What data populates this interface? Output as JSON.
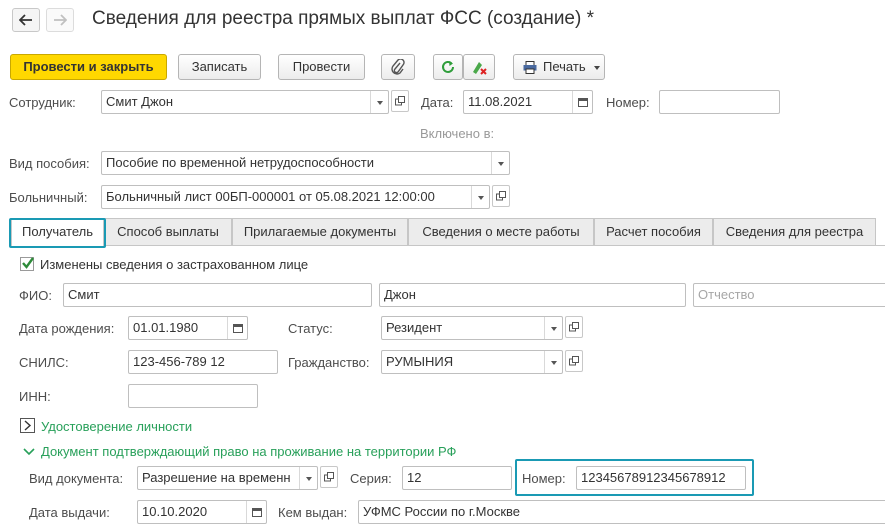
{
  "window": {
    "title": "Сведения для реестра прямых выплат ФСС (создание) *"
  },
  "toolbar": {
    "post_close": "Провести и закрыть",
    "save": "Записать",
    "post": "Провести",
    "print": "Печать"
  },
  "header": {
    "employee_label": "Сотрудник:",
    "employee_value": "Смит Джон",
    "date_label": "Дата:",
    "date_value": "11.08.2021",
    "number_label": "Номер:",
    "number_value": "",
    "included_label": "Включено в:",
    "benefit_label": "Вид пособия:",
    "benefit_value": "Пособие по временной нетрудоспособности",
    "sickleave_label": "Больничный:",
    "sickleave_value": "Больничный лист 00БП-000001 от 05.08.2021 12:00:00"
  },
  "tabs": [
    {
      "label": "Получатель",
      "active": true
    },
    {
      "label": "Способ выплаты",
      "active": false
    },
    {
      "label": "Прилагаемые документы",
      "active": false
    },
    {
      "label": "Сведения о месте работы",
      "active": false
    },
    {
      "label": "Расчет пособия",
      "active": false
    },
    {
      "label": "Сведения для реестра",
      "active": false
    }
  ],
  "recipient": {
    "changed_label": "Изменены сведения о застрахованном лице",
    "changed_checked": true,
    "fio_label": "ФИО:",
    "last_name": "Смит",
    "first_name": "Джон",
    "middle_name_placeholder": "Отчество",
    "birth_label": "Дата рождения:",
    "birth_value": "01.01.1980",
    "status_label": "Статус:",
    "status_value": "Резидент",
    "snils_label": "СНИЛС:",
    "snils_value": "123-456-789 12",
    "citizenship_label": "Гражданство:",
    "citizenship_value": "РУМЫНИЯ",
    "inn_label": "ИНН:",
    "inn_value": "",
    "id_group_label": "Удостоверение личности",
    "residence_group_label": "Документ подтверждающий право на проживание на территории РФ",
    "doc_type_label": "Вид документа:",
    "doc_type_value": "Разрешение на временн",
    "series_label": "Серия:",
    "series_value": "12",
    "doc_number_label": "Номер:",
    "doc_number_value": "12345678912345678912",
    "issue_date_label": "Дата выдачи:",
    "issue_date_value": "10.10.2020",
    "issued_by_label": "Кем выдан:",
    "issued_by_value": "УФМС России по г.Москве"
  },
  "colors": {
    "accent": "#1a9ab4",
    "primary_button": "#ffd800",
    "group_link": "#28a05a"
  }
}
